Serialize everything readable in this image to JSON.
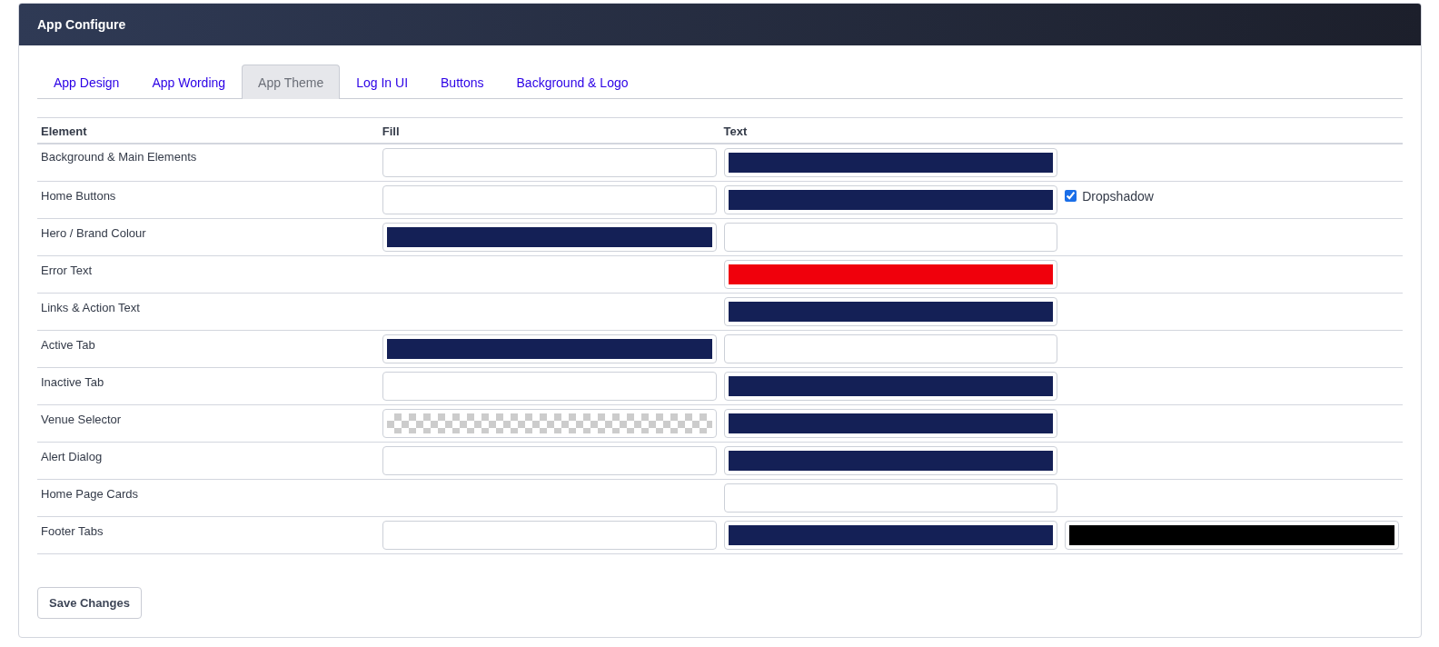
{
  "window": {
    "title": "App Configure"
  },
  "tabs": [
    {
      "label": "App Design",
      "selected": false
    },
    {
      "label": "App Wording",
      "selected": false
    },
    {
      "label": "App Theme",
      "selected": true
    },
    {
      "label": "Log In UI",
      "selected": false
    },
    {
      "label": "Buttons",
      "selected": false
    },
    {
      "label": "Background & Logo",
      "selected": false
    }
  ],
  "table": {
    "columns": [
      "Element",
      "Fill",
      "Text"
    ],
    "rows": [
      {
        "element": "Background & Main Elements",
        "fill": {
          "kind": "color",
          "color": "#ffffff"
        },
        "text": {
          "kind": "color",
          "color": "#142056"
        }
      },
      {
        "element": "Home Buttons",
        "fill": {
          "kind": "color",
          "color": "#ffffff"
        },
        "text": {
          "kind": "color",
          "color": "#142056"
        },
        "extra": {
          "kind": "checkbox",
          "label": "Dropshadow",
          "checked": true
        }
      },
      {
        "element": "Hero / Brand Colour",
        "fill": {
          "kind": "color",
          "color": "#142056"
        },
        "text": {
          "kind": "color",
          "color": "#ffffff"
        }
      },
      {
        "element": "Error Text",
        "text": {
          "kind": "color",
          "color": "#f0000c"
        }
      },
      {
        "element": "Links & Action Text",
        "text": {
          "kind": "color",
          "color": "#142056"
        }
      },
      {
        "element": "Active Tab",
        "fill": {
          "kind": "color",
          "color": "#142056"
        },
        "text": {
          "kind": "color",
          "color": "#ffffff"
        }
      },
      {
        "element": "Inactive Tab",
        "fill": {
          "kind": "color",
          "color": "#ffffff"
        },
        "text": {
          "kind": "color",
          "color": "#142056"
        }
      },
      {
        "element": "Venue Selector",
        "fill": {
          "kind": "transparent"
        },
        "text": {
          "kind": "color",
          "color": "#142056"
        }
      },
      {
        "element": "Alert Dialog",
        "fill": {
          "kind": "color",
          "color": "#ffffff"
        },
        "text": {
          "kind": "color",
          "color": "#142056"
        }
      },
      {
        "element": "Home Page Cards",
        "text": {
          "kind": "color",
          "color": "#ffffff"
        }
      },
      {
        "element": "Footer Tabs",
        "fill": {
          "kind": "color",
          "color": "#ffffff"
        },
        "text": {
          "kind": "color",
          "color": "#142056"
        },
        "extra": {
          "kind": "swatch",
          "color": "#000000"
        }
      }
    ]
  },
  "buttons": [
    "Save Changes"
  ]
}
